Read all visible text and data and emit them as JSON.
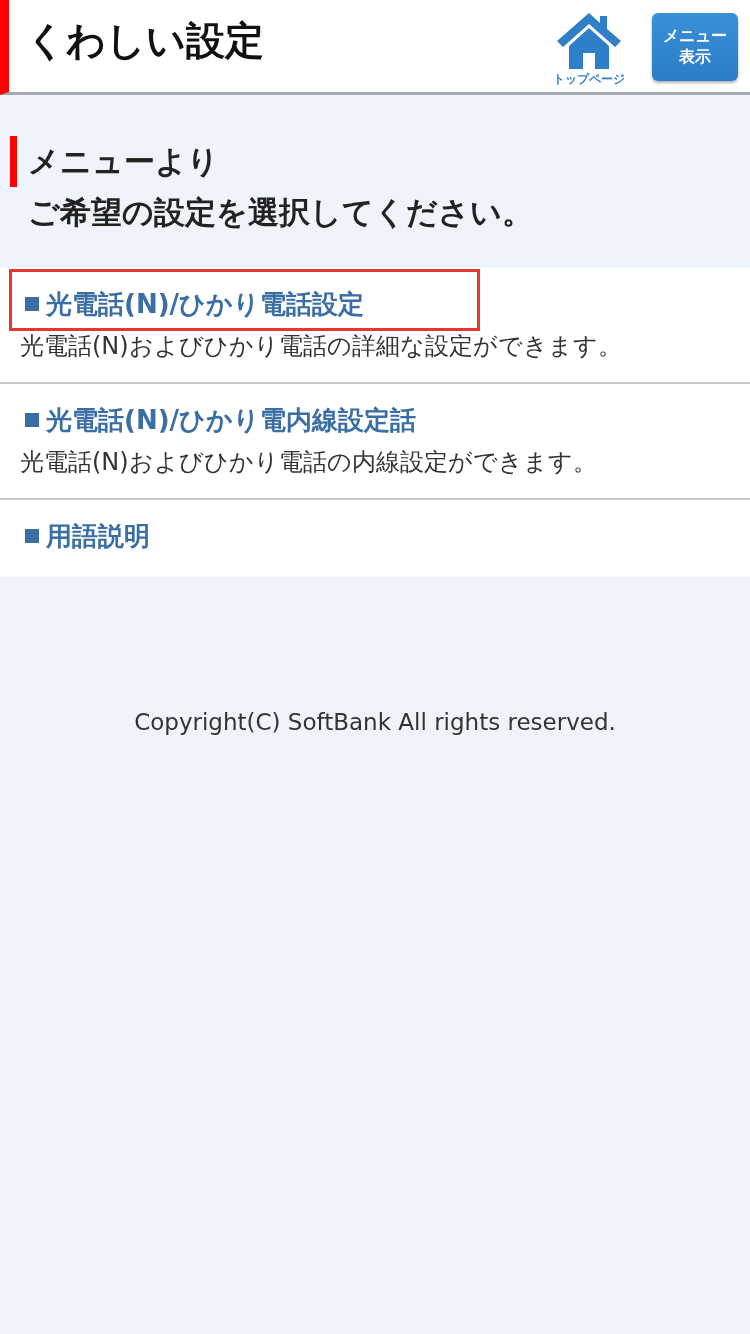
{
  "header": {
    "title": "くわしい設定",
    "home_label": "トップページ",
    "menu_button": [
      "メニュー",
      "表示"
    ]
  },
  "intro": {
    "lines": [
      "メニューより",
      "ご希望の設定を選択してください。"
    ]
  },
  "items": [
    {
      "title": "光電話(N)/ひかり電話設定",
      "description": "光電話(N)およびひかり電話の詳細な設定ができます。",
      "highlighted": true
    },
    {
      "title": "光電話(N)/ひかり電内線設定話",
      "description": "光電話(N)およびひかり電話の内線設定ができます。",
      "highlighted": false
    },
    {
      "title": "用語説明",
      "highlighted": false
    }
  ],
  "footer": {
    "copyright": "Copyright(C) SoftBank All rights reserved."
  }
}
